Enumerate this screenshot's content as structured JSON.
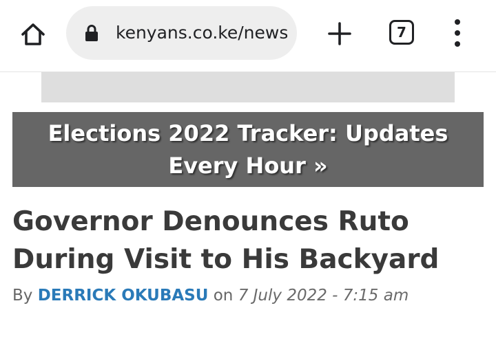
{
  "browser": {
    "url": "kenyans.co.ke/news/",
    "tab_count": "7",
    "icons": {
      "home": "home-icon",
      "lock": "lock-icon",
      "new_tab": "plus-icon",
      "tabs": "tab-switcher-icon",
      "menu": "kebab-menu-icon"
    }
  },
  "banner": {
    "text": "Elections 2022 Tracker: Updates Every Hour »",
    "background": "#666666"
  },
  "article": {
    "headline": "Governor Denounces Ruto During Visit to His Backyard",
    "by_label": "By",
    "author": "DERRICK OKUBASU",
    "on_label": "on",
    "date": "7 July 2022 - 7:15 am",
    "author_color": "#2a7ab8"
  }
}
